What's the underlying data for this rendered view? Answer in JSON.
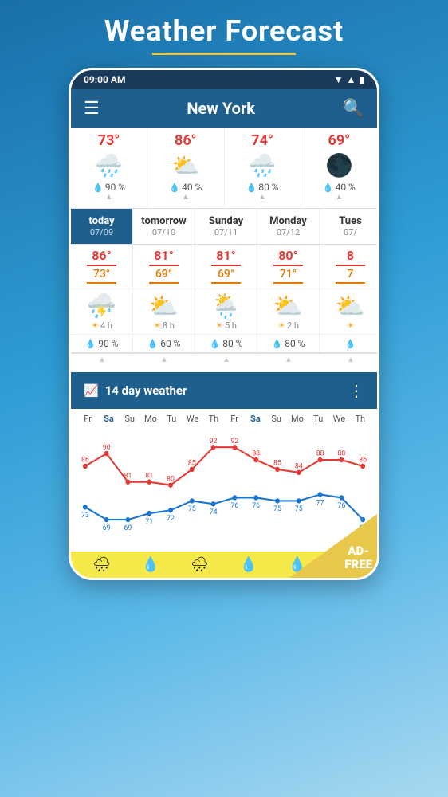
{
  "header": {
    "title": "Weather Forecast",
    "underline_color": "#e8c84a"
  },
  "status_bar": {
    "time": "09:00 AM",
    "icons": "▼ ▲ 📶 🔋"
  },
  "nav": {
    "city": "New York",
    "menu_icon": "☰",
    "search_icon": "🔍"
  },
  "hourly": [
    {
      "temp": "73°",
      "icon": "🌧",
      "rain": "90 %"
    },
    {
      "temp": "86°",
      "icon": "⛅",
      "rain": "40 %"
    },
    {
      "temp": "74°",
      "icon": "🌧",
      "rain": "80 %"
    },
    {
      "temp": "69°",
      "icon": "🌑",
      "rain": "40 %"
    }
  ],
  "forecast": {
    "days": [
      {
        "name": "today",
        "date": "07/09",
        "active": true
      },
      {
        "name": "tomorrow",
        "date": "07/10",
        "active": false
      },
      {
        "name": "Sunday",
        "date": "07/11",
        "active": false
      },
      {
        "name": "Monday",
        "date": "07/12",
        "active": false
      },
      {
        "name": "Tues",
        "date": "07/",
        "active": false
      }
    ],
    "high_temps": [
      "86°",
      "81°",
      "81°",
      "80°",
      "8"
    ],
    "low_temps": [
      "73°",
      "69°",
      "69°",
      "71°",
      "7"
    ],
    "sun_hours": [
      "4 h",
      "8 h",
      "5 h",
      "2 h",
      ""
    ],
    "rain_pcts": [
      "90 %",
      "60 %",
      "80 %",
      "80 %",
      ""
    ]
  },
  "fourteen_day": {
    "title": "14 day weather",
    "chart_icon": "📈",
    "day_labels": [
      "Fr",
      "Sa",
      "Su",
      "Mo",
      "Tu",
      "We",
      "Th",
      "Fr",
      "Sa",
      "Su",
      "Mo",
      "Tu",
      "We",
      "Th"
    ],
    "high_temps": [
      86,
      90,
      81,
      81,
      80,
      85,
      92,
      92,
      88,
      85,
      84,
      88,
      88,
      86
    ],
    "low_temps": [
      73,
      69,
      69,
      71,
      72,
      75,
      74,
      76,
      76,
      75,
      75,
      77,
      76,
      69
    ],
    "highlight_days": [
      1,
      8
    ]
  },
  "adfree": {
    "label": "AD-\nFREE"
  }
}
